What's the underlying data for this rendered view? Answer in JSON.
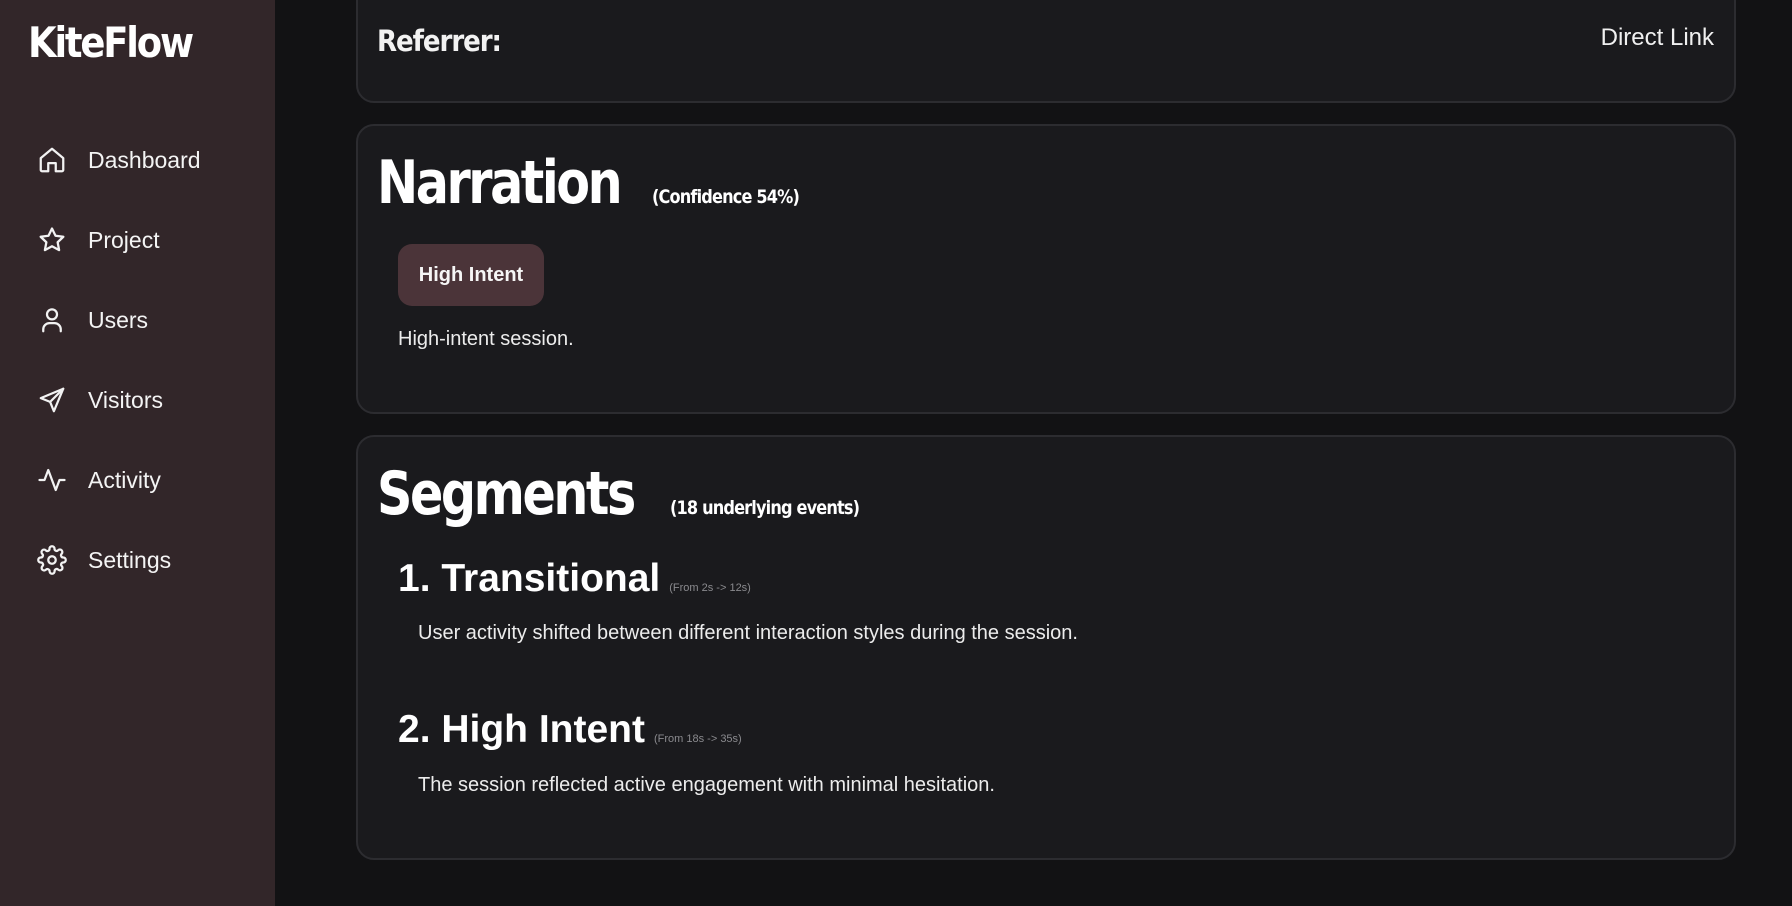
{
  "app": {
    "name": "KiteFlow"
  },
  "sidebar": {
    "items": [
      {
        "label": "Dashboard",
        "icon": "home-icon"
      },
      {
        "label": "Project",
        "icon": "star-icon"
      },
      {
        "label": "Users",
        "icon": "user-icon"
      },
      {
        "label": "Visitors",
        "icon": "send-icon"
      },
      {
        "label": "Activity",
        "icon": "activity-icon"
      },
      {
        "label": "Settings",
        "icon": "gear-icon"
      }
    ]
  },
  "referrer": {
    "label": "Referrer:",
    "value": "Direct Link"
  },
  "narration": {
    "title": "Narration",
    "confidence": "(Confidence 54%)",
    "badge": "High Intent",
    "text": "High-intent session."
  },
  "segments": {
    "title": "Segments",
    "subtitle": "(18 underlying events)",
    "items": [
      {
        "title": "1. Transitional",
        "range": "(From 2s -> 12s)",
        "description": "User activity shifted between different interaction styles during the session."
      },
      {
        "title": "2. High Intent",
        "range": "(From 18s -> 35s)",
        "description": "The session reflected active engagement with minimal hesitation."
      }
    ]
  },
  "colors": {
    "sidebar_bg": "#322629",
    "main_bg": "#121214",
    "card_bg": "#1a1a1d",
    "card_border": "#2c2c30",
    "badge_bg": "#4b3439"
  }
}
